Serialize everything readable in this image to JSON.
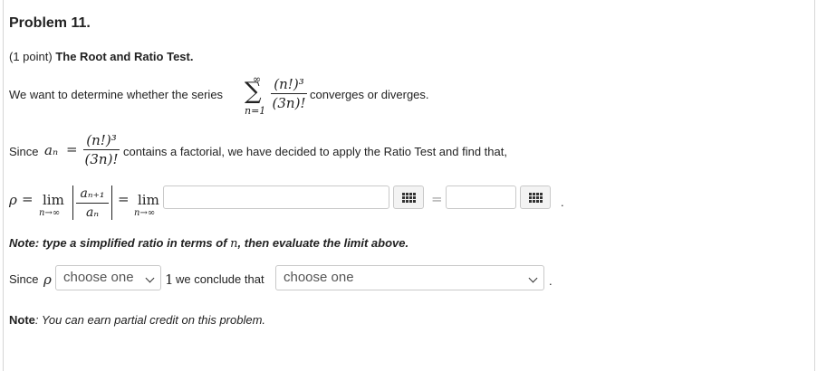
{
  "problem": {
    "title": "Problem 11.",
    "points": "(1 point)",
    "heading": "The Root and Ratio Test."
  },
  "intro": {
    "lead": "We want to determine whether the series",
    "sum_upper": "∞",
    "sum_sigma": "∑",
    "sum_lower": "n=1",
    "frac_num": "(n!)³",
    "frac_den": "(3n)!",
    "tail": "converges or diverges."
  },
  "since_an": {
    "lead": "Since",
    "a_n": "aₙ",
    "equals": "=",
    "frac_num": "(n!)³",
    "frac_den": "(3n)!",
    "tail": "contains a factorial, we have decided to apply the Ratio Test and find that,"
  },
  "ratio": {
    "rho": "ρ",
    "equals": "=",
    "lim": "lim",
    "lim_sub": "n→∞",
    "frac_num": "aₙ₊₁",
    "frac_den": "aₙ",
    "equals2": "=",
    "lim2": "lim",
    "lim2_sub": "n→∞",
    "input1_value": "",
    "equals3": "=",
    "input2_value": "",
    "end_period": "."
  },
  "note_simplify": {
    "text_a": "Note: type a simplified ratio in terms of",
    "var": "n",
    "text_b": ", then evaluate the limit above."
  },
  "conclusion": {
    "lead": "Since",
    "rho": "ρ",
    "select1": "choose one",
    "one": "1",
    "middle": "we conclude that",
    "select2": "choose one",
    "end_period": "."
  },
  "note_credit": {
    "label": "Note",
    "text": ": You can earn partial credit on this problem."
  },
  "icons": {
    "matrix": "grid-icon",
    "dropdown": "chevron-down-icon"
  }
}
